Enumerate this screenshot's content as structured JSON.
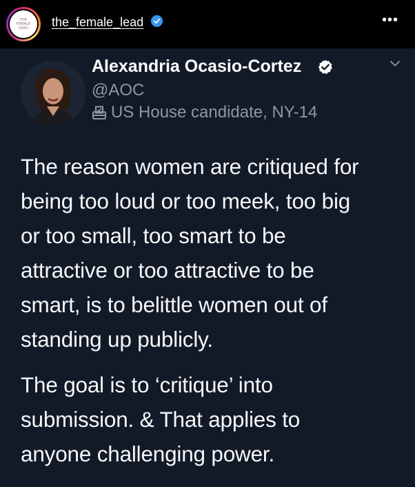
{
  "instagram": {
    "username": "the_female_lead",
    "avatar_logo_lines": [
      "THE",
      "FEMALE",
      "LEAD"
    ],
    "verified_icon": "verified-badge-icon",
    "more_label": "•••"
  },
  "tweet": {
    "author_name": "Alexandria Ocasio-Cortez",
    "author_handle": "@AOC",
    "author_bio": "US House candidate, NY-14",
    "bio_icon": "ballot-box-icon",
    "menu_icon": "chevron-down-icon",
    "paragraph1_lines": [
      "The reason women are critiqued for",
      "being too loud or too meek, too big",
      "or too small, too smart to be",
      "attractive or too attractive to be",
      "smart, is to belittle women out of",
      "standing up publicly."
    ],
    "paragraph2_lines": [
      "The goal is to ‘critique’ into",
      "submission. & That applies to",
      "anyone challenging power."
    ]
  },
  "colors": {
    "header_bg": "#000000",
    "tweet_bg": "#131a27",
    "secondary_text": "#8b98a5",
    "instagram_verified": "#3897f0"
  }
}
